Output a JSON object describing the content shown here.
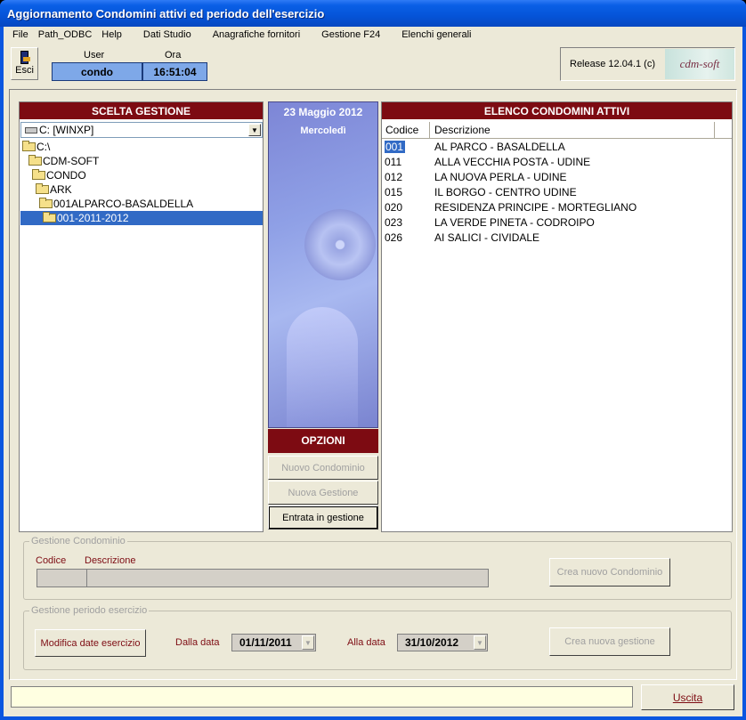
{
  "window": {
    "title": "Aggiornamento Condomini attivi ed periodo dell'esercizio"
  },
  "menu": [
    "File",
    "Path_ODBC",
    "Help",
    "Dati Studio",
    "Anagrafiche fornitori",
    "Gestione F24",
    "Elenchi generali"
  ],
  "toolbar": {
    "exit_label": "Esci",
    "exit_icon": "door-exit-icon"
  },
  "session": {
    "user_label": "User",
    "user_value": "condo",
    "time_label": "Ora",
    "time_value": "16:51:04"
  },
  "release": {
    "text": "Release 12.04.1 (c)",
    "logo": "cdm-soft"
  },
  "scelta": {
    "header": "SCELTA GESTIONE",
    "drive": "C: [WINXP]",
    "tree": [
      {
        "label": "C:\\",
        "icon": "folder-icon",
        "indent": 0
      },
      {
        "label": "CDM-SOFT",
        "icon": "folder-icon",
        "indent": 1
      },
      {
        "label": "CONDO",
        "icon": "folder-icon",
        "indent": 2
      },
      {
        "label": "ARK",
        "icon": "folder-icon",
        "indent": 3
      },
      {
        "label": "001ALPARCO-BASALDELLA",
        "icon": "folder-icon",
        "indent": 4
      },
      {
        "label": "001-2011-2012",
        "icon": "folder-open-icon",
        "indent": 5,
        "selected": true
      }
    ]
  },
  "calendar": {
    "date": "23  Maggio  2012",
    "day": "Mercoledì"
  },
  "opzioni": {
    "header": "OPZIONI",
    "nuovo_condominio": "Nuovo Condominio",
    "nuova_gestione": "Nuova Gestione",
    "entrata": "Entrata in gestione"
  },
  "elenco": {
    "header": "ELENCO CONDOMINI ATTIVI",
    "columns": [
      "Codice",
      "Descrizione"
    ],
    "rows": [
      {
        "codice": "001",
        "descrizione": "AL PARCO - BASALDELLA",
        "selected": true
      },
      {
        "codice": "011",
        "descrizione": "ALLA VECCHIA POSTA - UDINE"
      },
      {
        "codice": "012",
        "descrizione": "LA NUOVA PERLA - UDINE"
      },
      {
        "codice": "015",
        "descrizione": "IL BORGO - CENTRO UDINE"
      },
      {
        "codice": "020",
        "descrizione": "RESIDENZA PRINCIPE - MORTEGLIANO"
      },
      {
        "codice": "023",
        "descrizione": "LA VERDE PINETA - CODROIPO"
      },
      {
        "codice": "026",
        "descrizione": "AI SALICI - CIVIDALE"
      }
    ]
  },
  "gestione_condominio": {
    "legend": "Gestione Condominio",
    "codice_label": "Codice",
    "descrizione_label": "Descrizione",
    "crea_button": "Crea nuovo Condominio"
  },
  "gestione_periodo": {
    "legend": "Gestione periodo esercizio",
    "modifica_button": "Modifica date esercizio",
    "dalla_label": "Dalla data",
    "dalla_value": "01/11/2011",
    "alla_label": "Alla data",
    "alla_value": "31/10/2012",
    "crea_button": "Crea nuova gestione"
  },
  "footer": {
    "status": "",
    "uscita": "Uscita"
  },
  "colors": {
    "accent_red": "#7d0b12",
    "title_blue": "#0a56e0",
    "selection": "#316ac5",
    "user_box": "#7ea8e8"
  }
}
